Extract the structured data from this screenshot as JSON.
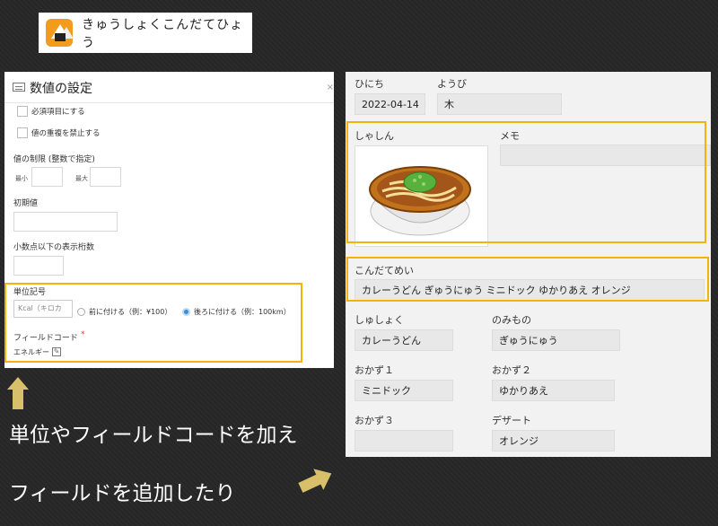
{
  "app": {
    "title": "きゅうしょくこんだてひょう",
    "icon": "onigiri-icon"
  },
  "settings": {
    "title": "数値の設定",
    "close": "×",
    "required_label": "必須項目にする",
    "unique_label": "値の重複を禁止する",
    "limit_label": "値の制限 (整数で指定)",
    "min_label": "最小",
    "max_label": "最大",
    "default_label": "初期値",
    "decimal_label": "小数点以下の表示桁数",
    "unit_label": "単位記号",
    "unit_value": "Kcal（キロカ",
    "prefix_option": "前に付ける（例：¥100）",
    "suffix_option": "後ろに付ける（例：100km）",
    "selected_option": "suffix",
    "field_code_label": "フィールドコード",
    "required_mark": "*",
    "field_code_value": "エネルギー"
  },
  "captions": {
    "line1": "単位やフィールドコードを加え",
    "line2": "フィールドを追加したり"
  },
  "form": {
    "date_label": "ひにち",
    "date_value": "2022-04-14",
    "weekday_label": "ようび",
    "weekday_value": "木",
    "photo_label": "しゃしん",
    "memo_label": "メモ",
    "memo_value": "",
    "menu_name_label": "こんだてめい",
    "menu_name_value": "カレーうどん ぎゅうにゅう ミニドック ゆかりあえ オレンジ",
    "staple_label": "しゅしょく",
    "staple_value": "カレーうどん",
    "drink_label": "のみもの",
    "drink_value": "ぎゅうにゅう",
    "side1_label": "おかず１",
    "side1_value": "ミニドック",
    "side2_label": "おかず２",
    "side2_value": "ゆかりあえ",
    "side3_label": "おかず３",
    "side3_value": "",
    "dessert_label": "デザート",
    "dessert_value": "オレンジ"
  },
  "colors": {
    "highlight": "#f3b409",
    "arrow": "#d8c06a",
    "radio_selected": "#3a8fd8"
  }
}
